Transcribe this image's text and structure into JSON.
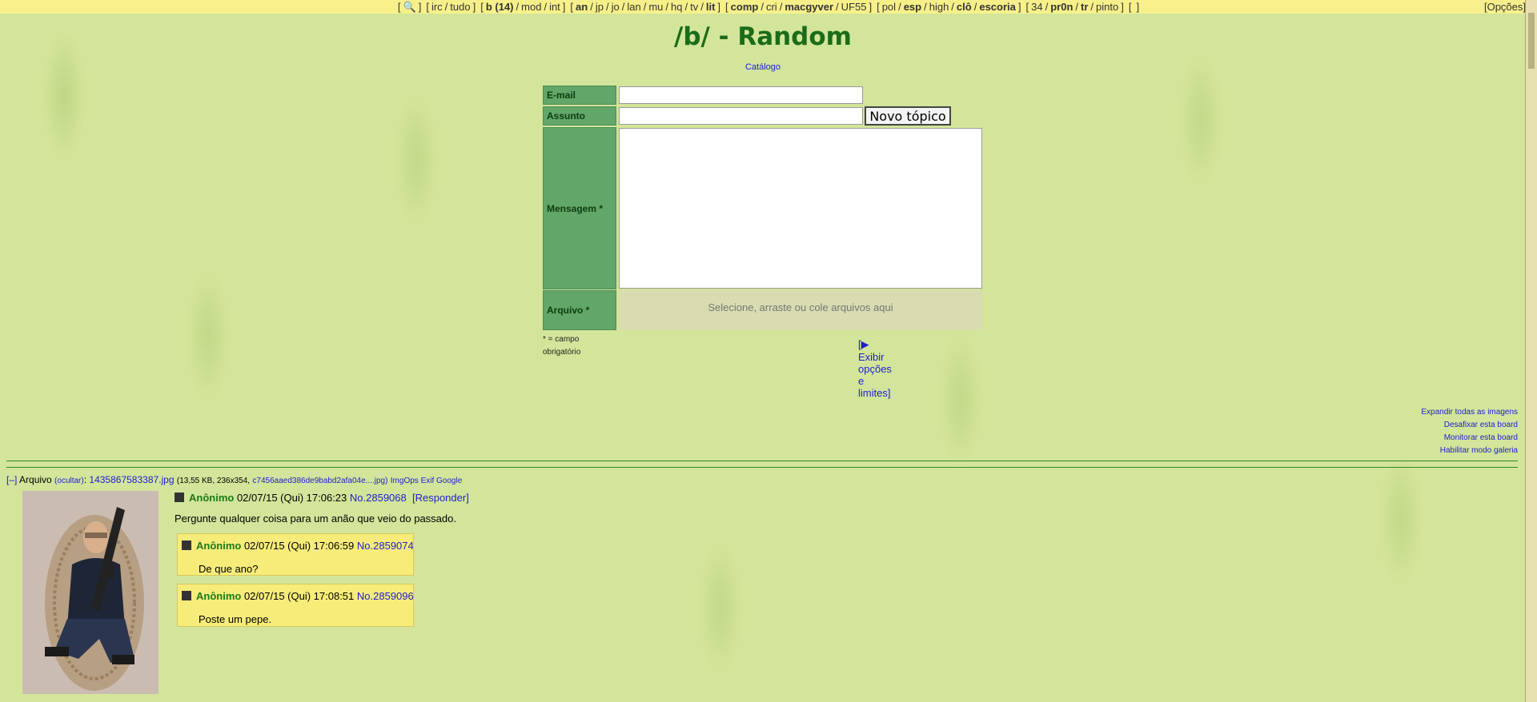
{
  "topnav": {
    "groups": [
      [
        {
          "t": "🔍",
          "b": false
        }
      ],
      [
        {
          "t": "irc",
          "b": false
        },
        {
          "t": "tudo",
          "b": false
        }
      ],
      [
        {
          "t": "b (14)",
          "b": true
        },
        {
          "t": "mod",
          "b": false
        },
        {
          "t": "int",
          "b": false
        }
      ],
      [
        {
          "t": "an",
          "b": true
        },
        {
          "t": "jp",
          "b": false
        },
        {
          "t": "jo",
          "b": false
        },
        {
          "t": "lan",
          "b": false
        },
        {
          "t": "mu",
          "b": false
        },
        {
          "t": "hq",
          "b": false
        },
        {
          "t": "tv",
          "b": false
        },
        {
          "t": "lit",
          "b": true
        }
      ],
      [
        {
          "t": "comp",
          "b": true
        },
        {
          "t": "cri",
          "b": false
        },
        {
          "t": "macgyver",
          "b": true
        },
        {
          "t": "UF55",
          "b": false
        }
      ],
      [
        {
          "t": "pol",
          "b": false
        },
        {
          "t": "esp",
          "b": true
        },
        {
          "t": "high",
          "b": false
        },
        {
          "t": "clô",
          "b": true
        },
        {
          "t": "escoria",
          "b": true
        }
      ],
      [
        {
          "t": "34",
          "b": false
        },
        {
          "t": "pr0n",
          "b": true
        },
        {
          "t": "tr",
          "b": true
        },
        {
          "t": "pinto",
          "b": false
        }
      ],
      []
    ],
    "options": "[Opções]"
  },
  "board_title": "/b/ - Random",
  "catalog_link": "Catálogo",
  "form": {
    "email_label": "E-mail",
    "subject_label": "Assunto",
    "message_label": "Mensagem *",
    "file_label": "Arquivo *",
    "submit": "Novo tópico",
    "dropzone": "Selecione, arraste ou cole arquivos aqui",
    "required_note_1": "* = campo",
    "required_note_2": "obrigatório",
    "options_link": "[▶ Exibir opções e limites]"
  },
  "board_links": [
    "Expandir todas as imagens",
    "Desafixar esta board",
    "Monitorar esta board",
    "Habilitar modo galeria"
  ],
  "thread": {
    "collapse": "[–]",
    "file_word": "Arquivo",
    "hide": "(ocultar)",
    "filename": "1435867583387.jpg",
    "fileinfo": "(13,55 KB, 236x354,",
    "hash_name": "c7456aaed386de9babd2afa04e....jpg)",
    "tools": "ImgOps Exif Google",
    "op": {
      "name": "Anônimo",
      "date": "02/07/15 (Qui) 17:06:23",
      "no": "No.2859068",
      "reply": "[Responder]",
      "text": "Pergunte qualquer coisa para um anão que veio do passado."
    },
    "replies": [
      {
        "name": "Anônimo",
        "date": "02/07/15 (Qui) 17:06:59",
        "no": "No.2859074",
        "text": "De que ano?"
      },
      {
        "name": "Anônimo",
        "date": "02/07/15 (Qui) 17:08:51",
        "no": "No.2859096",
        "text": "Poste um pepe."
      }
    ]
  }
}
